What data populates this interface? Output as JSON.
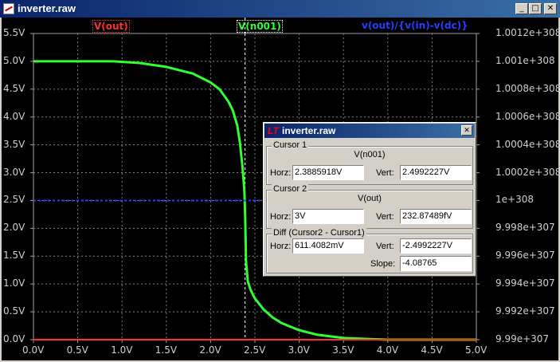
{
  "window": {
    "title": "inverter.raw",
    "btn_min": "_",
    "btn_max": "□",
    "btn_close": "✕"
  },
  "plot": {
    "traces": [
      {
        "name": "V(out)",
        "color": "#ff3030",
        "box": "#ff3030"
      },
      {
        "name": "V(n001)",
        "color": "#30ff30",
        "box": "#ffffff"
      },
      {
        "name": "v(out)/{v(in)-v(dc)}",
        "color": "#2a3cff"
      }
    ],
    "y_left_ticks": [
      "5.5V",
      "5.0V",
      "4.5V",
      "4.0V",
      "3.5V",
      "3.0V",
      "2.5V",
      "2.0V",
      "1.5V",
      "1.0V",
      "0.5V",
      "0.0V"
    ],
    "y_right_ticks": [
      "1.0012e+308",
      "1.001e+308",
      "1.0008e+308",
      "1.0006e+308",
      "1.0004e+308",
      "1.0002e+308",
      "1e+308",
      "9.998e+307",
      "9.996e+307",
      "9.994e+307",
      "9.992e+307",
      "9.99e+307"
    ],
    "x_ticks": [
      "0.0V",
      "0.5V",
      "1.0V",
      "1.5V",
      "2.0V",
      "2.5V",
      "3.0V",
      "3.5V",
      "4.0V",
      "4.5V",
      "5.0V"
    ]
  },
  "chart_data": {
    "type": "line",
    "x_range": [
      0,
      5
    ],
    "y_range": [
      0,
      5.5
    ],
    "series": [
      {
        "name": "V(n001)",
        "x": [
          0,
          0.5,
          0.9,
          1.2,
          1.5,
          1.8,
          2.0,
          2.1,
          2.2,
          2.25,
          2.3,
          2.33,
          2.36,
          2.38,
          2.385,
          2.39,
          2.4,
          2.42,
          2.45,
          2.5,
          2.6,
          2.7,
          2.8,
          3.0,
          3.2,
          3.5,
          3.8,
          4.0,
          4.5,
          5.0
        ],
        "values": [
          5.0,
          5.0,
          5.0,
          4.97,
          4.9,
          4.78,
          4.62,
          4.5,
          4.28,
          4.12,
          3.85,
          3.55,
          3.1,
          2.7,
          2.5,
          2.2,
          1.4,
          1.05,
          0.9,
          0.74,
          0.54,
          0.4,
          0.3,
          0.17,
          0.09,
          0.03,
          0.01,
          0.0,
          0.0,
          0.0
        ]
      },
      {
        "name": "V(out)",
        "x": [
          0,
          5
        ],
        "values": [
          0,
          0
        ]
      },
      {
        "name": "v(out)/{v(in)-v(dc)}",
        "x": [
          0,
          5
        ],
        "values": [
          2.5,
          2.5
        ]
      }
    ]
  },
  "cursor_dialog": {
    "title": "inverter.raw",
    "close": "✕",
    "cursor1": {
      "label": "Cursor 1",
      "trace": "V(n001)",
      "horz_label": "Horz:",
      "horz": "2.3885918V",
      "vert_label": "Vert:",
      "vert": "2.4992227V"
    },
    "cursor2": {
      "label": "Cursor 2",
      "trace": "V(out)",
      "horz_label": "Horz:",
      "horz": "3V",
      "vert_label": "Vert:",
      "vert": "232.87489fV"
    },
    "diff": {
      "label": "Diff (Cursor2 - Cursor1)",
      "horz_label": "Horz:",
      "horz": "611.4082mV",
      "vert_label": "Vert:",
      "vert": "-2.4992227V",
      "slope_label": "Slope:",
      "slope": "-4.08765"
    }
  }
}
